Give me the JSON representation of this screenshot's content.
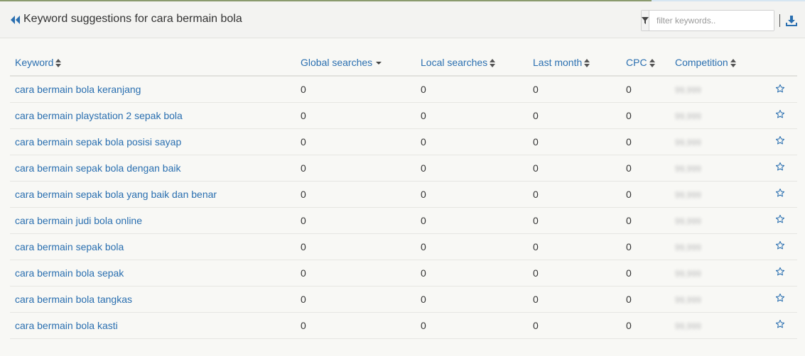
{
  "header": {
    "title": "Keyword suggestions for cara bermain bola",
    "filter_placeholder": "filter keywords..",
    "icons": {
      "back": "double-chevron-left-icon",
      "filter": "funnel-icon",
      "download": "download-icon"
    },
    "separator": "|"
  },
  "colors": {
    "link": "#2a6fb0",
    "text": "#333333",
    "background": "#f8f8f5"
  },
  "table": {
    "columns": [
      {
        "key": "keyword",
        "label": "Keyword",
        "sort": "both"
      },
      {
        "key": "global",
        "label": "Global searches",
        "sort": "desc"
      },
      {
        "key": "local",
        "label": "Local searches",
        "sort": "both"
      },
      {
        "key": "last_month",
        "label": "Last month",
        "sort": "both"
      },
      {
        "key": "cpc",
        "label": "CPC",
        "sort": "both"
      },
      {
        "key": "competition",
        "label": "Competition",
        "sort": "both"
      }
    ],
    "rows": [
      {
        "keyword": "cara bermain bola keranjang",
        "global": "0",
        "local": "0",
        "last_month": "0",
        "cpc": "0",
        "competition": "99,999"
      },
      {
        "keyword": "cara bermain playstation 2 sepak bola",
        "global": "0",
        "local": "0",
        "last_month": "0",
        "cpc": "0",
        "competition": "99,999"
      },
      {
        "keyword": "cara bermain sepak bola posisi sayap",
        "global": "0",
        "local": "0",
        "last_month": "0",
        "cpc": "0",
        "competition": "99,999"
      },
      {
        "keyword": "cara bermain sepak bola dengan baik",
        "global": "0",
        "local": "0",
        "last_month": "0",
        "cpc": "0",
        "competition": "99,999"
      },
      {
        "keyword": "cara bermain sepak bola yang baik dan benar",
        "global": "0",
        "local": "0",
        "last_month": "0",
        "cpc": "0",
        "competition": "99,999"
      },
      {
        "keyword": "cara bermain judi bola online",
        "global": "0",
        "local": "0",
        "last_month": "0",
        "cpc": "0",
        "competition": "99,999"
      },
      {
        "keyword": "cara bermain sepak bola",
        "global": "0",
        "local": "0",
        "last_month": "0",
        "cpc": "0",
        "competition": "99,999"
      },
      {
        "keyword": "cara bermain bola sepak",
        "global": "0",
        "local": "0",
        "last_month": "0",
        "cpc": "0",
        "competition": "99,999"
      },
      {
        "keyword": "cara bermain bola tangkas",
        "global": "0",
        "local": "0",
        "last_month": "0",
        "cpc": "0",
        "competition": "99,999"
      },
      {
        "keyword": "cara bermain bola kasti",
        "global": "0",
        "local": "0",
        "last_month": "0",
        "cpc": "0",
        "competition": "99,999"
      }
    ],
    "row_action_icon": "star-outline-icon"
  }
}
